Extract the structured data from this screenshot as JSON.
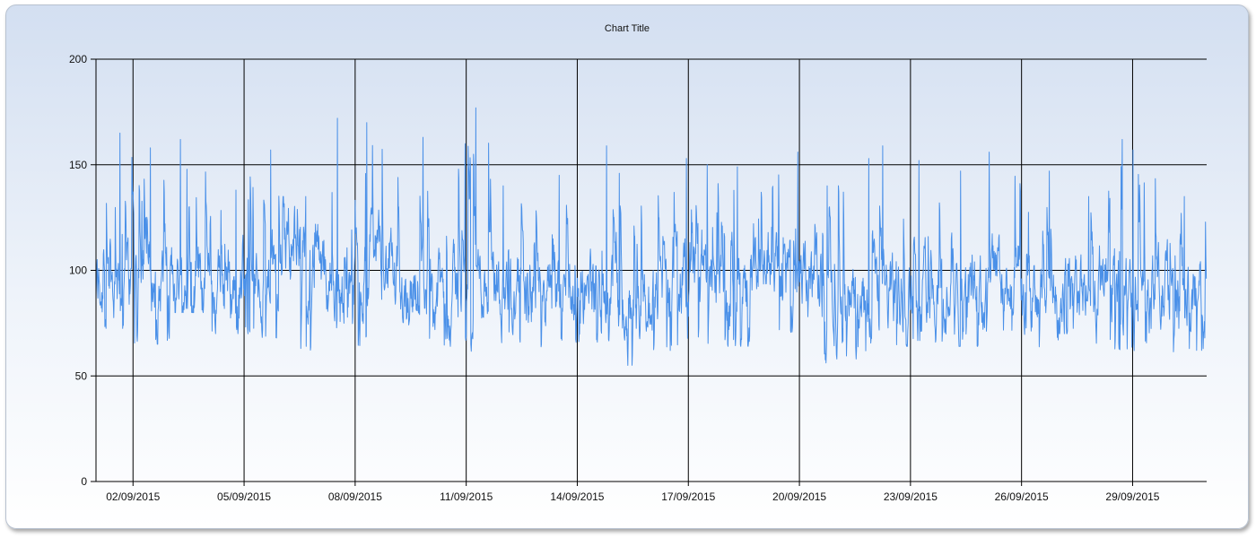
{
  "chart_data": {
    "type": "line",
    "title": "Chart Title",
    "xlabel": "",
    "ylabel": "",
    "ylim": [
      0,
      200
    ],
    "yticks": [
      0,
      50,
      100,
      150,
      200
    ],
    "x_start": "2015-09-01",
    "x_end": "2015-09-30",
    "xticks": [
      "02/09/2015",
      "05/09/2015",
      "08/09/2015",
      "11/09/2015",
      "14/09/2015",
      "17/09/2015",
      "20/09/2015",
      "23/09/2015",
      "26/09/2015",
      "29/09/2015"
    ],
    "grid": true,
    "legend": "none",
    "series": [
      {
        "color": "#4a90e8",
        "x": [
          "2015-09-01",
          "2015-09-02",
          "2015-09-03",
          "2015-09-04",
          "2015-09-05",
          "2015-09-06",
          "2015-09-07",
          "2015-09-08",
          "2015-09-09",
          "2015-09-10",
          "2015-09-11",
          "2015-09-12",
          "2015-09-13",
          "2015-09-14",
          "2015-09-15",
          "2015-09-16",
          "2015-09-17",
          "2015-09-18",
          "2015-09-19",
          "2015-09-20",
          "2015-09-21",
          "2015-09-22",
          "2015-09-23",
          "2015-09-24",
          "2015-09-25",
          "2015-09-26",
          "2015-09-27",
          "2015-09-28",
          "2015-09-29",
          "2015-09-30"
        ],
        "mean": [
          92,
          95,
          98,
          92,
          95,
          112,
          96,
          102,
          92,
          90,
          95,
          88,
          90,
          90,
          78,
          92,
          95,
          92,
          98,
          90,
          82,
          88,
          90,
          88,
          92,
          82,
          88,
          92,
          90,
          86
        ],
        "min": [
          70,
          65,
          80,
          70,
          68,
          60,
          72,
          64,
          58,
          64,
          60,
          66,
          62,
          66,
          55,
          62,
          64,
          64,
          70,
          55,
          58,
          64,
          66,
          64,
          66,
          62,
          70,
          62,
          62,
          58
        ],
        "max": [
          165,
          158,
          162,
          138,
          157,
          135,
          172,
          170,
          163,
          160,
          177,
          140,
          145,
          159,
          146,
          153,
          150,
          149,
          156,
          140,
          153,
          159,
          152,
          147,
          156,
          147,
          135,
          162,
          157,
          135
        ]
      }
    ]
  }
}
